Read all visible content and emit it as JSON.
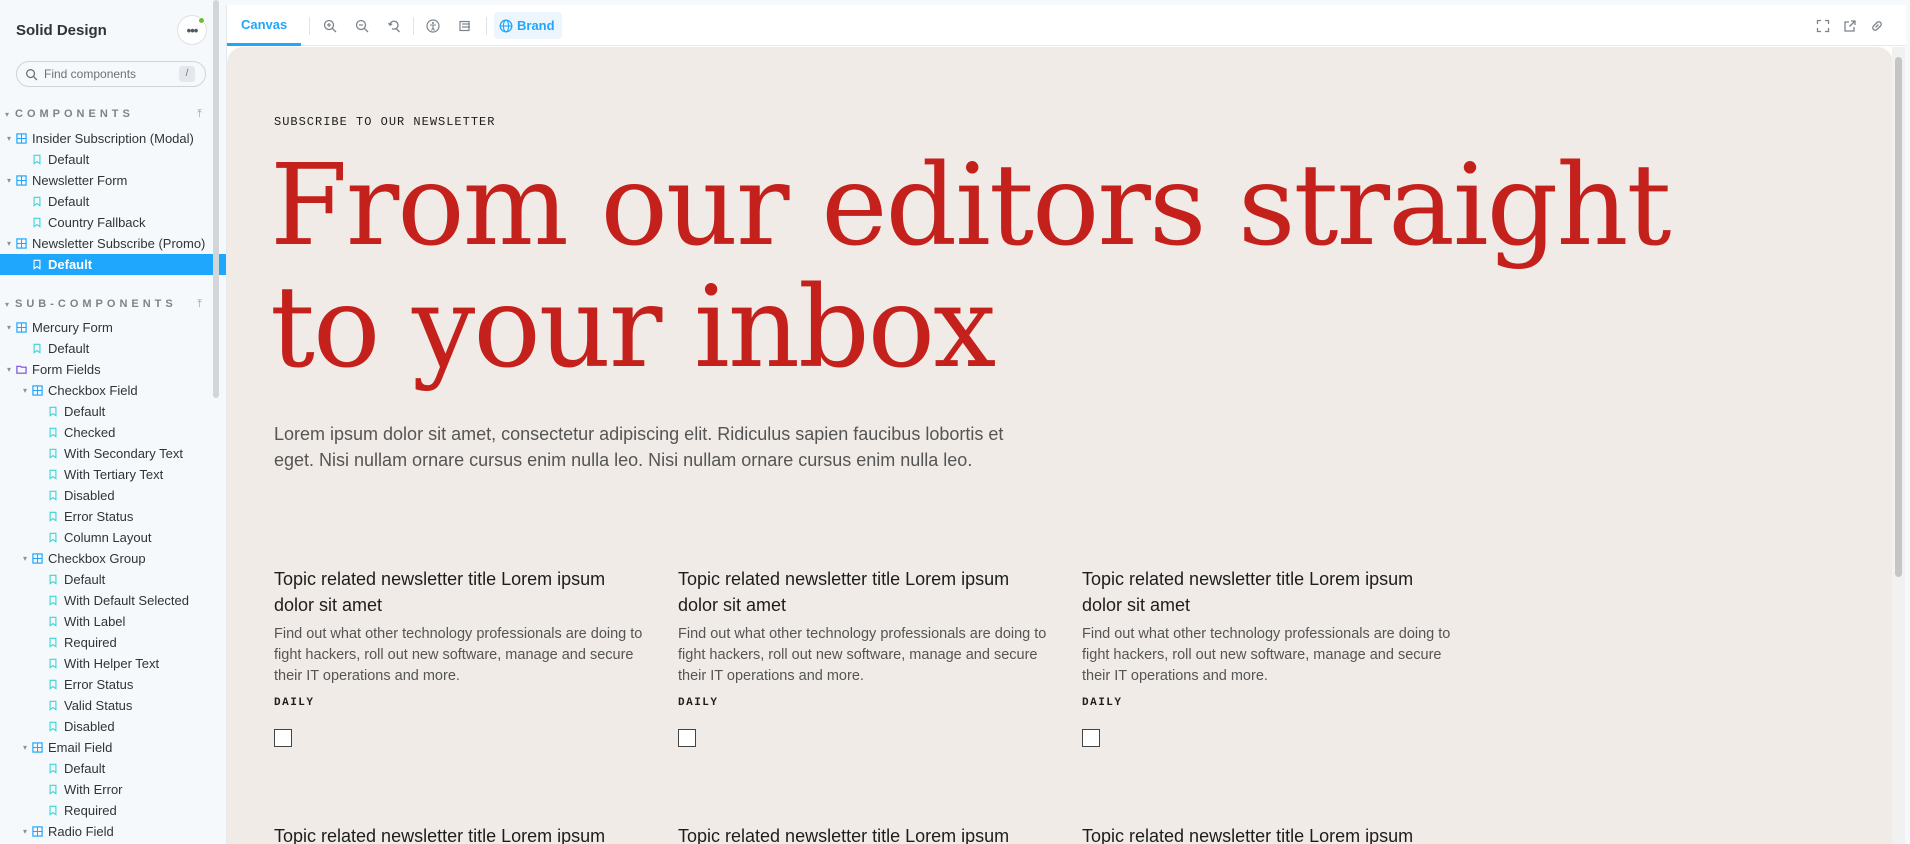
{
  "sidebar": {
    "title": "Solid Design",
    "search_placeholder": "Find components",
    "search_shortcut": "/",
    "sections": {
      "components": "COMPONENTS",
      "sub_components": "SUB-COMPONENTS"
    },
    "tree": [
      {
        "label": "Insider Subscription (Modal)",
        "type": "component",
        "level": 0
      },
      {
        "label": "Default",
        "type": "story",
        "level": 1
      },
      {
        "label": "Newsletter Form",
        "type": "component",
        "level": 0
      },
      {
        "label": "Default",
        "type": "story",
        "level": 1
      },
      {
        "label": "Country Fallback",
        "type": "story",
        "level": 1
      },
      {
        "label": "Newsletter Subscribe (Promo)",
        "type": "component",
        "level": 0
      },
      {
        "label": "Default",
        "type": "story",
        "level": 1,
        "selected": true
      },
      {
        "label": "Mercury Form",
        "type": "component",
        "level": 0
      },
      {
        "label": "Default",
        "type": "story",
        "level": 1
      },
      {
        "label": "Form Fields",
        "type": "folder",
        "level": 0
      },
      {
        "label": "Checkbox Field",
        "type": "component",
        "level": 1
      },
      {
        "label": "Default",
        "type": "story",
        "level": 2
      },
      {
        "label": "Checked",
        "type": "story",
        "level": 2
      },
      {
        "label": "With Secondary Text",
        "type": "story",
        "level": 2
      },
      {
        "label": "With Tertiary Text",
        "type": "story",
        "level": 2
      },
      {
        "label": "Disabled",
        "type": "story",
        "level": 2
      },
      {
        "label": "Error Status",
        "type": "story",
        "level": 2
      },
      {
        "label": "Column Layout",
        "type": "story",
        "level": 2
      },
      {
        "label": "Checkbox Group",
        "type": "component",
        "level": 1
      },
      {
        "label": "Default",
        "type": "story",
        "level": 2
      },
      {
        "label": "With Default Selected",
        "type": "story",
        "level": 2
      },
      {
        "label": "With Label",
        "type": "story",
        "level": 2
      },
      {
        "label": "Required",
        "type": "story",
        "level": 2
      },
      {
        "label": "With Helper Text",
        "type": "story",
        "level": 2
      },
      {
        "label": "Error Status",
        "type": "story",
        "level": 2
      },
      {
        "label": "Valid Status",
        "type": "story",
        "level": 2
      },
      {
        "label": "Disabled",
        "type": "story",
        "level": 2
      },
      {
        "label": "Email Field",
        "type": "component",
        "level": 1
      },
      {
        "label": "Default",
        "type": "story",
        "level": 2
      },
      {
        "label": "With Error",
        "type": "story",
        "level": 2
      },
      {
        "label": "Required",
        "type": "story",
        "level": 2
      },
      {
        "label": "Radio Field",
        "type": "component",
        "level": 1
      }
    ]
  },
  "toolbar": {
    "tab_canvas": "Canvas",
    "brand_label": "Brand"
  },
  "canvas": {
    "eyebrow": "SUBSCRIBE TO OUR NEWSLETTER",
    "headline_line1": "From our editors straight",
    "headline_line2": "to your inbox",
    "intro": "Lorem ipsum dolor sit amet, consectetur adipiscing elit. Ridiculus sapien faucibus lobortis et eget. Nisi nullam ornare cursus enim nulla leo. Nisi nullam ornare cursus enim nulla leo.",
    "cards": [
      {
        "title": "Topic related newsletter title Lorem ipsum dolor sit amet",
        "desc": "Find out what other technology professionals are doing to fight hackers, roll out new software, manage and secure their IT operations and more.",
        "freq": "DAILY"
      },
      {
        "title": "Topic related newsletter title Lorem ipsum dolor sit amet",
        "desc": "Find out what other technology professionals are doing to fight hackers, roll out new software, manage and secure their IT operations and more.",
        "freq": "DAILY"
      },
      {
        "title": "Topic related newsletter title Lorem ipsum dolor sit amet",
        "desc": "Find out what other technology professionals are doing to fight hackers, roll out new software, manage and secure their IT operations and more.",
        "freq": "DAILY"
      },
      {
        "title": "Topic related newsletter title Lorem ipsum dolor sit amet"
      },
      {
        "title": "Topic related newsletter title Lorem ipsum dolor sit amet"
      },
      {
        "title": "Topic related newsletter title Lorem ipsum dolor sit amet"
      }
    ]
  },
  "colors": {
    "accent": "#1ea7fd",
    "headline": "#c4211d",
    "canvas_bg": "#f0ebe6",
    "status_online": "#66bf3c"
  }
}
